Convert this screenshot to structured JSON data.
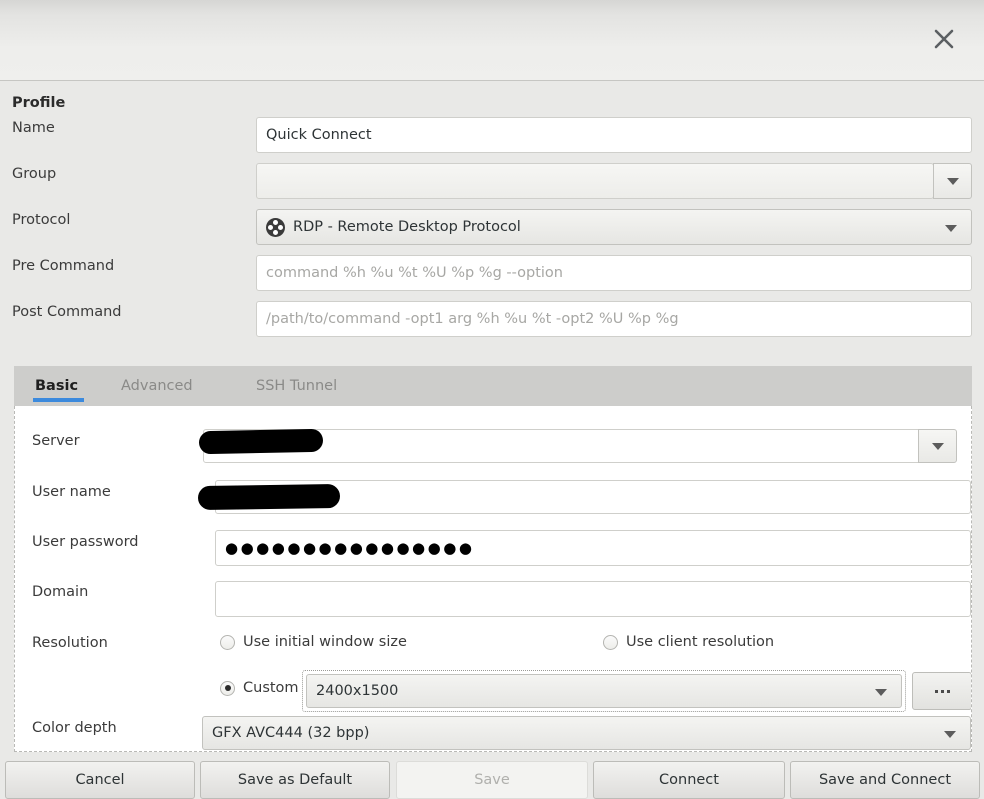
{
  "window": {
    "close_icon": "close-icon"
  },
  "profile": {
    "section_title": "Profile",
    "fields": {
      "name": {
        "label": "Name",
        "value": "Quick Connect"
      },
      "group": {
        "label": "Group",
        "value": ""
      },
      "protocol": {
        "label": "Protocol",
        "value": "RDP - Remote Desktop Protocol",
        "icon": "rdp-protocol-icon"
      },
      "pre_command": {
        "label": "Pre Command",
        "value": "",
        "placeholder": "command %h %u %t %U %p %g --option"
      },
      "post_command": {
        "label": "Post Command",
        "value": "",
        "placeholder": "/path/to/command -opt1 arg %h %u %t -opt2 %U %p %g"
      }
    }
  },
  "tabs": [
    {
      "label": "Basic",
      "active": true
    },
    {
      "label": "Advanced",
      "active": false
    },
    {
      "label": "SSH Tunnel",
      "active": false
    }
  ],
  "basic": {
    "server": {
      "label": "Server",
      "value": "",
      "redacted": true
    },
    "user_name": {
      "label": "User name",
      "value": "",
      "redacted": true
    },
    "user_password": {
      "label": "User password",
      "value": "●●●●●●●●●●●●●●●●"
    },
    "domain": {
      "label": "Domain",
      "value": ""
    },
    "resolution": {
      "label": "Resolution",
      "options": [
        {
          "label": "Use initial window size",
          "selected": false
        },
        {
          "label": "Use client resolution",
          "selected": false
        },
        {
          "label": "Custom",
          "selected": true
        }
      ],
      "custom_value": "2400x1500",
      "more_button": "..."
    },
    "color_depth": {
      "label": "Color depth",
      "value": "GFX AVC444 (32 bpp)"
    }
  },
  "buttons": [
    {
      "label": "Cancel",
      "disabled": false
    },
    {
      "label": "Save as Default",
      "disabled": false
    },
    {
      "label": "Save",
      "disabled": true
    },
    {
      "label": "Connect",
      "disabled": false
    },
    {
      "label": "Save and Connect",
      "disabled": false
    }
  ],
  "colors": {
    "accent": "#3c8add",
    "window_bg": "#e9e9e7",
    "tabbar_bg": "#cdcdcb",
    "panel_bg": "#ffffff"
  }
}
